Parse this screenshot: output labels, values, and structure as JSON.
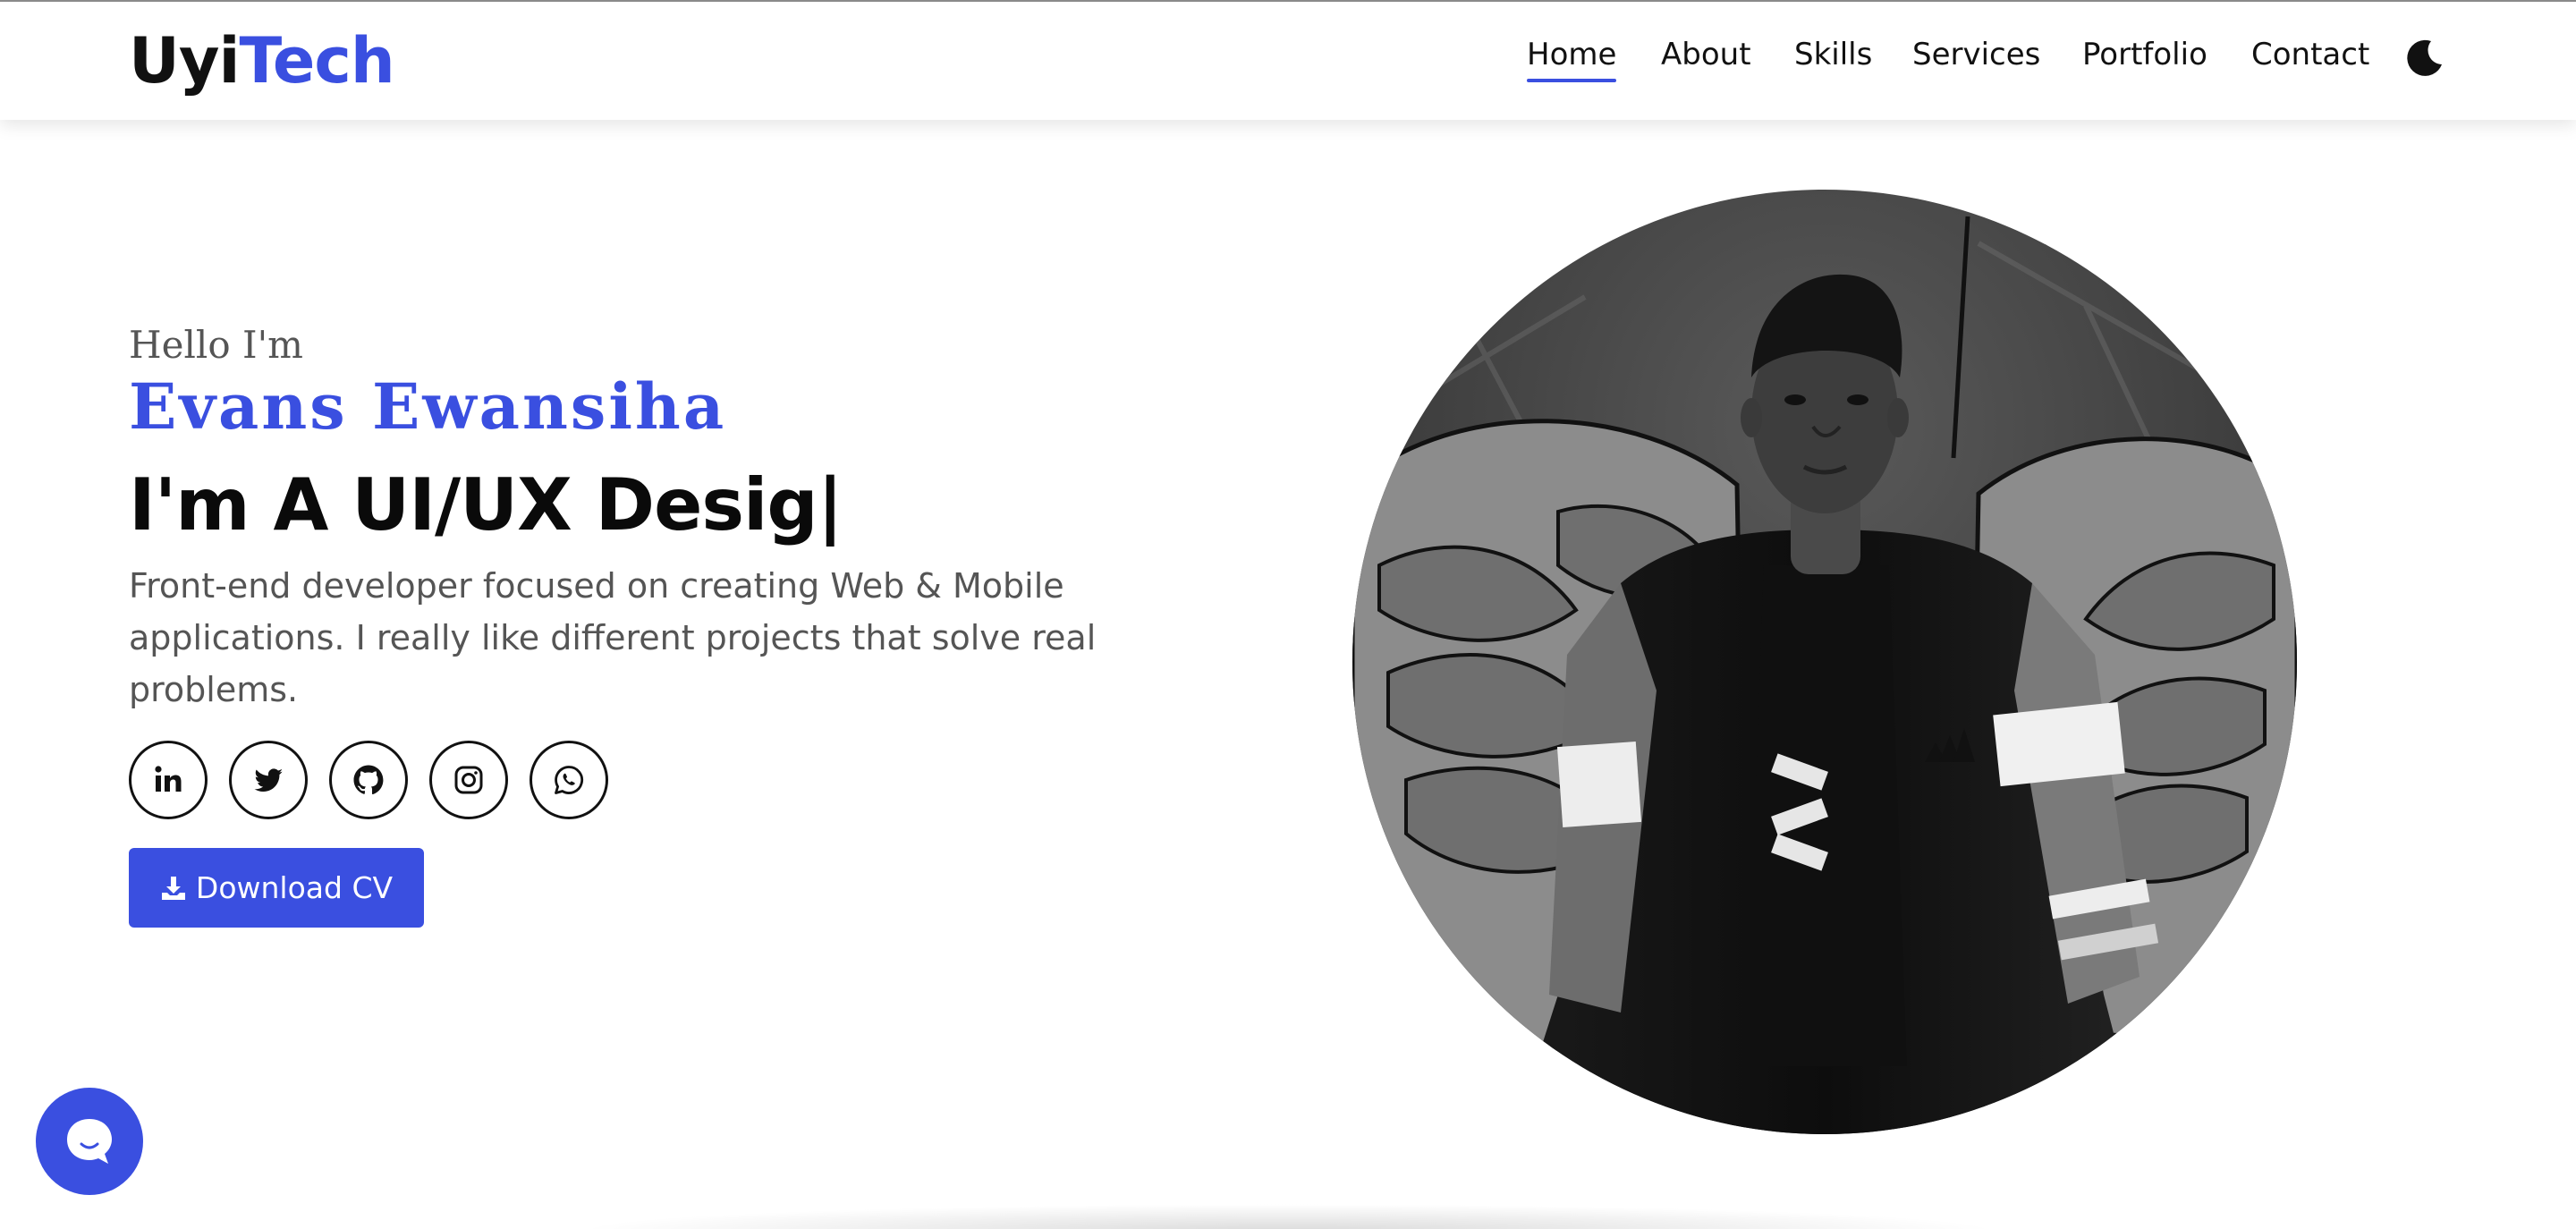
{
  "header": {
    "logo": {
      "part1": "Uyi",
      "part2": "Tech"
    },
    "nav": [
      {
        "label": "Home",
        "active": true
      },
      {
        "label": "About",
        "active": false
      },
      {
        "label": "Skills",
        "active": false
      },
      {
        "label": "Services",
        "active": false
      },
      {
        "label": "Portfolio",
        "active": false
      },
      {
        "label": "Contact",
        "active": false
      }
    ],
    "theme_toggle_icon": "moon-icon"
  },
  "hero": {
    "greeting": "Hello I'm",
    "name": "Evans Ewansiha",
    "role": "I'm A UI/UX Desig|",
    "intro": "Front-end developer focused on creating Web & Mobile applications. I really like different projects that solve real problems.",
    "socials": [
      {
        "icon": "linkedin-icon"
      },
      {
        "icon": "twitter-icon"
      },
      {
        "icon": "github-icon"
      },
      {
        "icon": "instagram-icon"
      },
      {
        "icon": "whatsapp-icon"
      }
    ],
    "cv_button": {
      "icon": "download-icon",
      "label": "Download CV"
    },
    "portrait": "grayscale photo of a young man in a zip-up jacket in front of a painted wings mural"
  },
  "chat_widget": {
    "icon": "chat-bubble-icon"
  },
  "colors": {
    "accent": "#3a4fe0",
    "text_dark": "#111111",
    "text_muted": "#555555",
    "background": "#ffffff"
  }
}
